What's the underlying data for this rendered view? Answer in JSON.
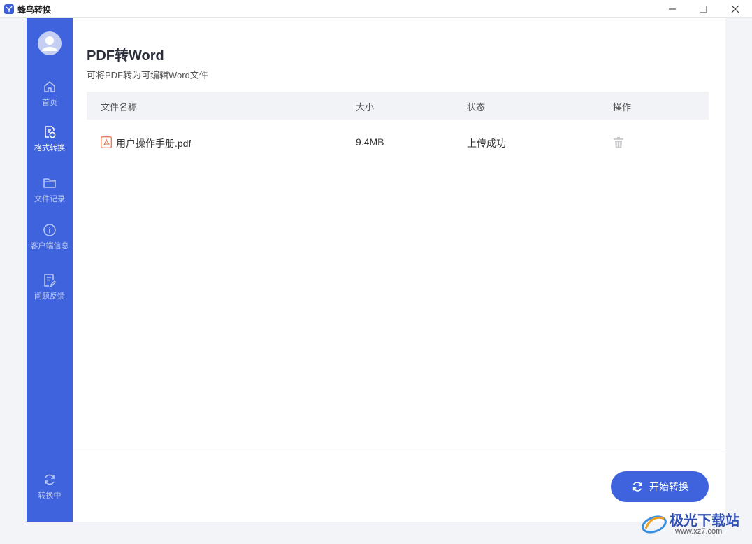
{
  "window": {
    "title": "蜂鸟转换"
  },
  "sidebar": {
    "items": [
      {
        "label": "首页",
        "icon": "home-icon"
      },
      {
        "label": "格式转换",
        "icon": "convert-icon"
      },
      {
        "label": "文件记录",
        "icon": "folder-icon"
      },
      {
        "label": "客户端信息",
        "icon": "info-icon"
      },
      {
        "label": "问题反馈",
        "icon": "feedback-icon"
      }
    ],
    "bottom_item": {
      "label": "转换中",
      "icon": "refresh-icon"
    },
    "active_index": 1
  },
  "main": {
    "title": "PDF转Word",
    "subtitle": "可将PDF转为可编辑Word文件",
    "table": {
      "headers": [
        "文件名称",
        "大小",
        "状态",
        "操作"
      ],
      "rows": [
        {
          "name": "用户操作手册.pdf",
          "size": "9.4MB",
          "status": "上传成功"
        }
      ]
    },
    "start_button": "开始转换"
  },
  "watermark": {
    "text": "极光下载站",
    "url": "www.xz7.com"
  },
  "colors": {
    "accent": "#3f63dc",
    "pdf_icon": "#e8744a"
  }
}
